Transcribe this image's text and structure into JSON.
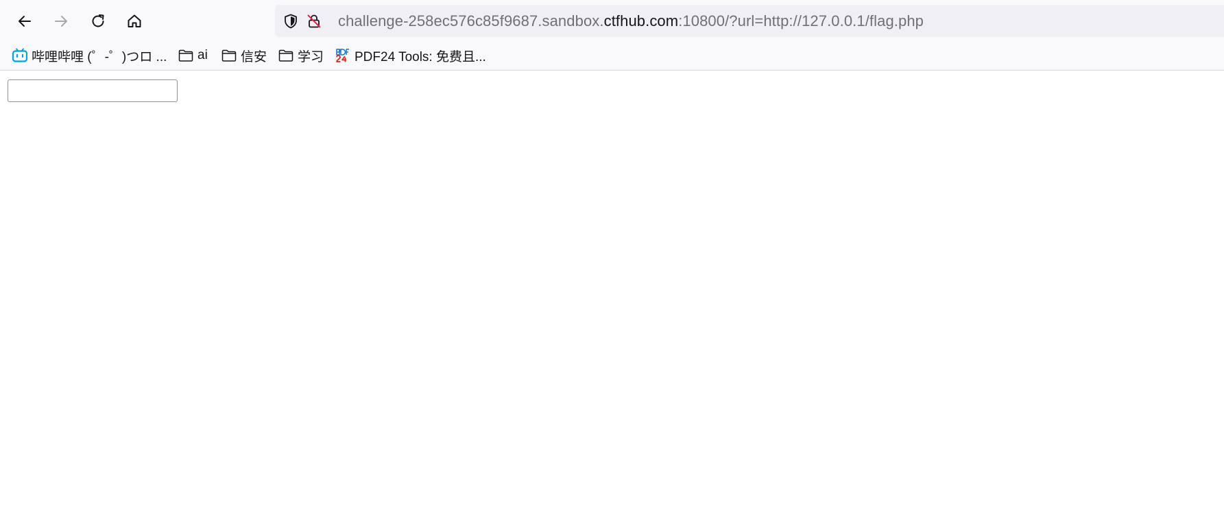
{
  "toolbar": {
    "back_icon": "arrow-left-icon",
    "forward_icon": "arrow-right-icon",
    "reload_icon": "reload-icon",
    "home_icon": "home-icon"
  },
  "url_bar": {
    "prefix": "challenge-258ec576c85f9687.sandbox.",
    "domain": "ctfhub.com",
    "suffix": ":10800/?url=http://127.0.0.1/flag.php",
    "tracking_icon": "shield-icon",
    "security_icon": "insecure-lock-icon"
  },
  "bookmarks": [
    {
      "label": "哔哩哔哩 (゜-゜)つロ ...",
      "icon": "bilibili-icon"
    },
    {
      "label": "ai",
      "icon": "folder-icon"
    },
    {
      "label": "信安",
      "icon": "folder-icon"
    },
    {
      "label": "学习",
      "icon": "folder-icon"
    },
    {
      "label": "PDF24 Tools: 免费且...",
      "icon": "pdf24-icon"
    }
  ],
  "page": {
    "input_value": ""
  },
  "colors": {
    "chrome_bg": "#f9f9fb",
    "urlbar_bg": "#f0f0f4",
    "url_muted": "#6f6f76",
    "url_domain": "#15141a",
    "bilibili_blue": "#00a1d6",
    "pdf24_red": "#e2231a"
  }
}
